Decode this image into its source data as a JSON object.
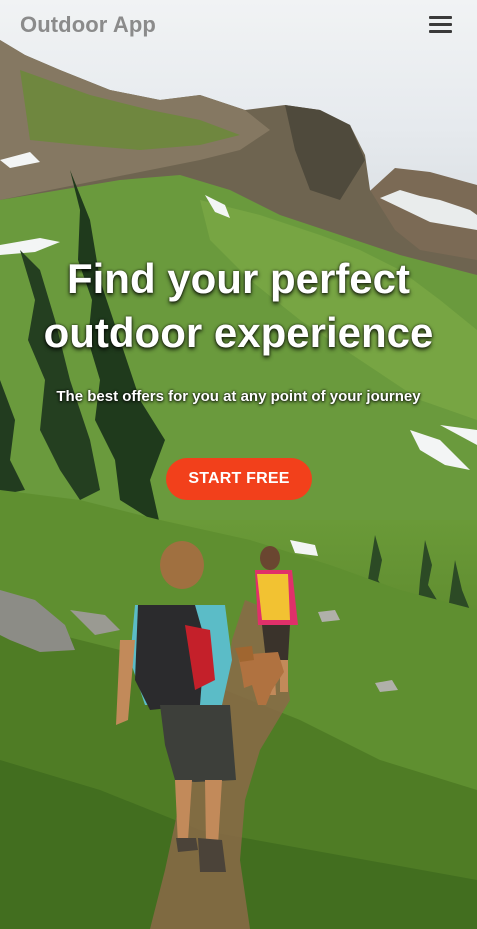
{
  "header": {
    "app_title": "Outdoor App",
    "menu_icon": "hamburger-menu-icon"
  },
  "hero": {
    "title_line1": "Find your perfect",
    "title_line2": "outdoor experience",
    "subtitle": "The best offers for you at any point of your journey",
    "cta_label": "START FREE",
    "background": "mountain-hikers-photo"
  },
  "colors": {
    "cta": "#f2401b",
    "logo": "#8b8b8b",
    "menu_icon": "#3a3a3a",
    "hero_text": "#ffffff"
  }
}
